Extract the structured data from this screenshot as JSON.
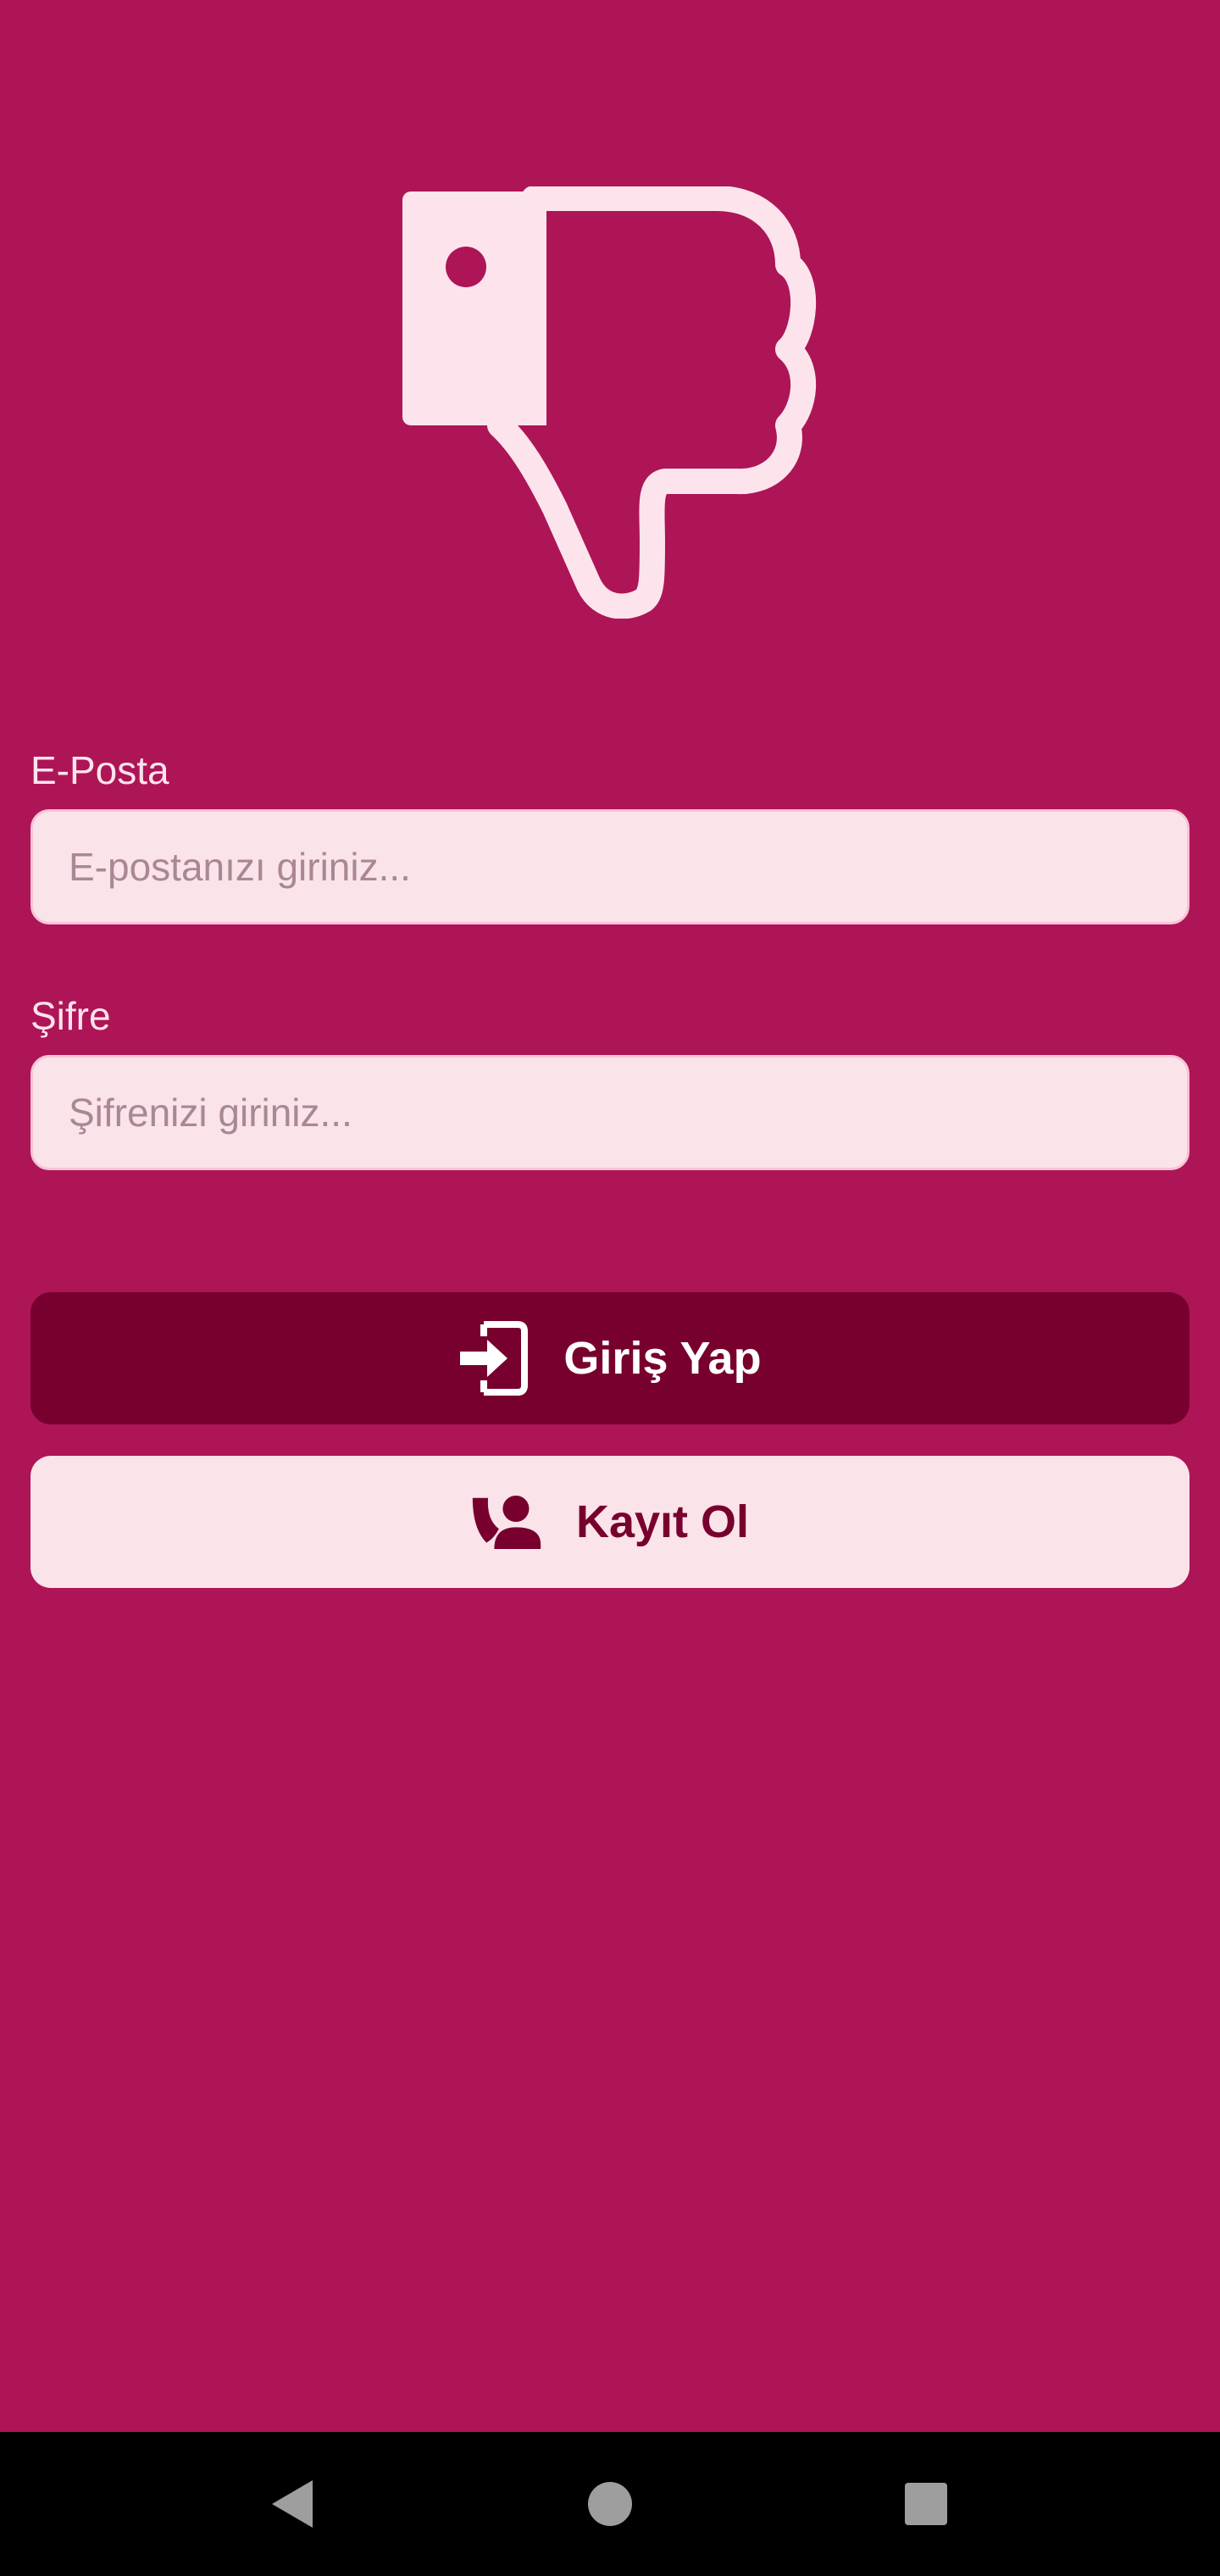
{
  "colors": {
    "background": "#ad1556",
    "field_background": "#fbe3ea",
    "primary_button": "#78002e",
    "secondary_button": "#fbe3ea",
    "label_text": "#fde4ec",
    "nav_bar": "#000000"
  },
  "logo": {
    "icon": "thumbs-down-icon"
  },
  "email": {
    "label": "E-Posta",
    "placeholder": "E-postanızı giriniz...",
    "value": ""
  },
  "password": {
    "label": "Şifre",
    "placeholder": "Şifrenizi giriniz...",
    "value": ""
  },
  "buttons": {
    "login": {
      "label": "Giriş Yap",
      "icon": "login-icon"
    },
    "register": {
      "label": "Kayıt Ol",
      "icon": "person-add-icon"
    }
  },
  "navigation": {
    "back_icon": "back-triangle-icon",
    "home_icon": "home-circle-icon",
    "recents_icon": "recents-square-icon"
  }
}
